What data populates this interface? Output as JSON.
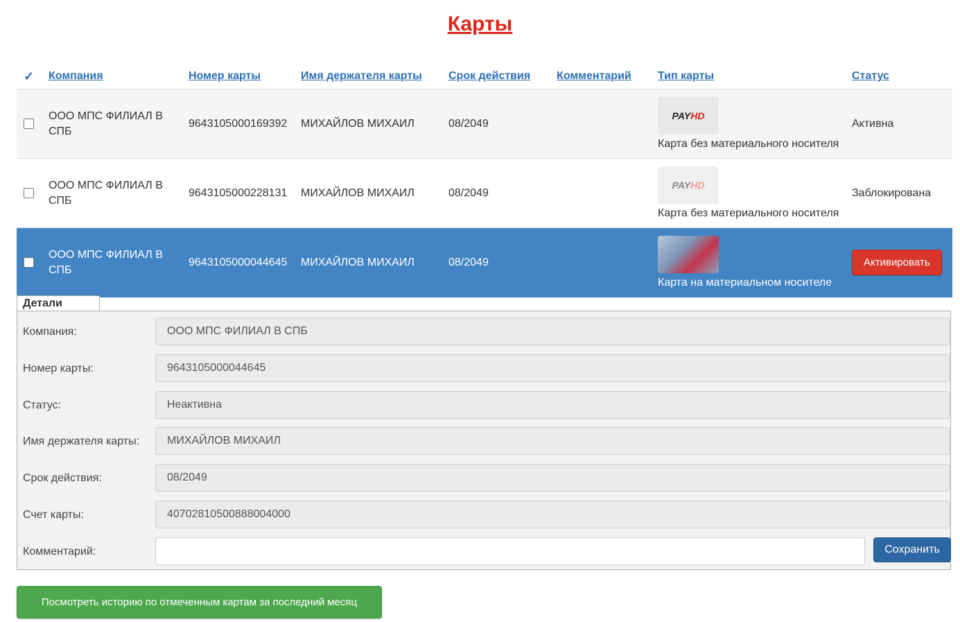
{
  "title": "Карты",
  "table": {
    "headers": {
      "check": "✓",
      "company": "Компания",
      "card_number": "Номер карты",
      "holder": "Имя держателя карты",
      "expiry": "Срок действия",
      "comment": "Комментарий",
      "card_type": "Тип карты",
      "status": "Статус"
    },
    "rows": [
      {
        "company": "ООО МПС ФИЛИАЛ В СПБ",
        "card_number": "9643105000169392",
        "holder": "МИХАЙЛОВ МИХАИЛ",
        "expiry": "08/2049",
        "comment": "",
        "card_type": "Карта без материального носителя",
        "card_logo_a": "PAY",
        "card_logo_b": "HD",
        "status": "Активна"
      },
      {
        "company": "ООО МПС ФИЛИАЛ В СПБ",
        "card_number": "9643105000228131",
        "holder": "МИХАЙЛОВ МИХАИЛ",
        "expiry": "08/2049",
        "comment": "",
        "card_type": "Карта без материального носителя",
        "card_logo_a": "PAY",
        "card_logo_b": "HD",
        "status": "Заблокирована"
      },
      {
        "company": "ООО МПС ФИЛИАЛ В СПБ",
        "card_number": "9643105000044645",
        "holder": "МИХАЙЛОВ МИХАИЛ",
        "expiry": "08/2049",
        "comment": "",
        "card_type": "Карта на материальном носителе",
        "action_label": "Активировать"
      }
    ]
  },
  "details": {
    "tab_label": "Детали",
    "fields": [
      {
        "label": "Компания:",
        "value": "ООО МПС ФИЛИАЛ В СПБ"
      },
      {
        "label": "Номер карты:",
        "value": "9643105000044645"
      },
      {
        "label": "Статус:",
        "value": "Неактивна"
      },
      {
        "label": "Имя держателя карты:",
        "value": "МИХАЙЛОВ МИХАИЛ"
      },
      {
        "label": "Срок действия:",
        "value": "08/2049"
      },
      {
        "label": "Счет карты:",
        "value": "40702810500888004000"
      }
    ],
    "comment_label": "Комментарий:",
    "comment_value": "",
    "save_label": "Сохранить"
  },
  "history_button": "Посмотреть историю по отмеченным картам за последний месяц",
  "colors": {
    "title": "#e0261c",
    "link": "#2a6fb8",
    "selected_row": "#4384c4",
    "activate": "#d9372b",
    "save": "#2d67a3",
    "history": "#4da84d"
  }
}
